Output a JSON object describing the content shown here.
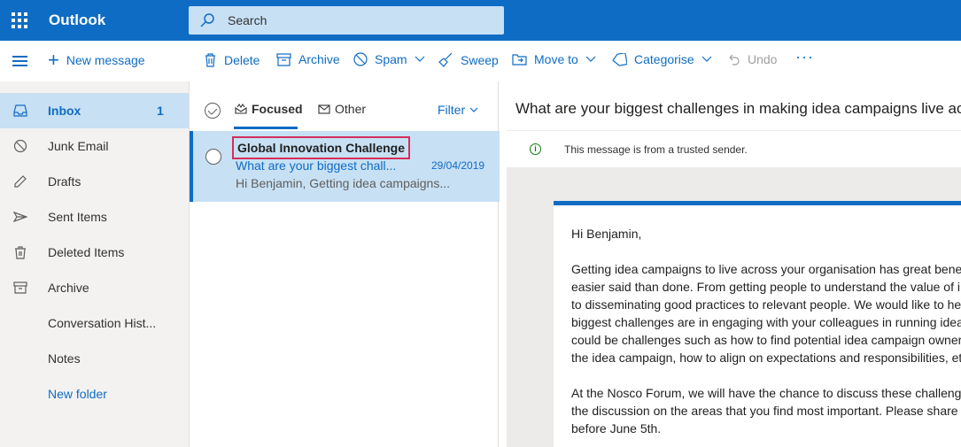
{
  "app": {
    "title": "Outlook"
  },
  "search": {
    "placeholder": "Search"
  },
  "toolbar": {
    "new_message": "New message",
    "delete": "Delete",
    "archive": "Archive",
    "spam": "Spam",
    "sweep": "Sweep",
    "move_to": "Move to",
    "categorise": "Categorise",
    "undo": "Undo",
    "more": "···"
  },
  "sidebar": {
    "items": [
      {
        "label": "Inbox",
        "count": "1",
        "icon": "inbox-icon"
      },
      {
        "label": "Junk Email",
        "icon": "junk-icon"
      },
      {
        "label": "Drafts",
        "icon": "pencil-icon"
      },
      {
        "label": "Sent Items",
        "icon": "send-icon"
      },
      {
        "label": "Deleted Items",
        "icon": "trash-icon"
      },
      {
        "label": "Archive",
        "icon": "archive-icon"
      },
      {
        "label": "Conversation Hist..."
      },
      {
        "label": "Notes"
      },
      {
        "label": "New folder"
      }
    ]
  },
  "message_list": {
    "tabs": {
      "focused": "Focused",
      "other": "Other"
    },
    "filter": "Filter",
    "messages": [
      {
        "sender": "Global Innovation Challenge",
        "subject": "What are your biggest chall...",
        "date": "29/04/2019",
        "preview": "Hi Benjamin, Getting idea campaigns..."
      }
    ]
  },
  "reading_pane": {
    "subject": "What are your biggest challenges in making idea campaigns live acr",
    "trusted_notice": "This message is from a trusted sender.",
    "body": [
      "Hi Benjamin,",
      "Getting idea campaigns to live across your organisation has great bene",
      "easier said than done. From getting people to understand the value of i",
      "to disseminating good practices to relevant people. We would like to he",
      "biggest challenges are in engaging with your colleagues in running idea",
      "could be challenges such as how to find potential idea campaign owner",
      "the idea campaign, how to align on expectations and responsibilities, et",
      "At the Nosco Forum, we will have the chance to discuss these challeng",
      "the discussion on the areas that you find most important. Please share",
      "before June 5th."
    ]
  },
  "colors": {
    "brand": "#0f6cc4",
    "selected": "#c7e0f4",
    "highlight_border": "#d42e5b"
  }
}
